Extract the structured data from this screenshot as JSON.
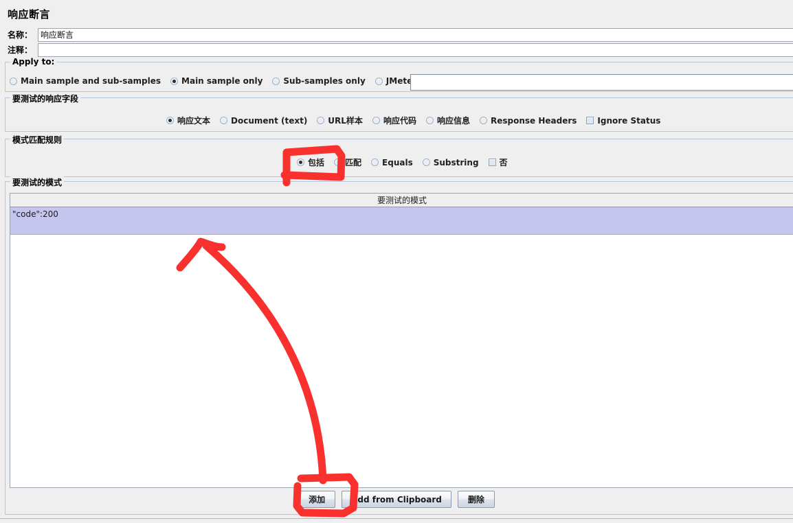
{
  "window": {
    "title": "响应断言"
  },
  "fields": {
    "name_label": "名称：",
    "name_value": "响应断言",
    "comment_label": "注释：",
    "comment_value": ""
  },
  "apply_to": {
    "title": "Apply to:",
    "options": [
      {
        "label": "Main sample and sub-samples",
        "selected": false
      },
      {
        "label": "Main sample only",
        "selected": true
      },
      {
        "label": "Sub-samples only",
        "selected": false
      },
      {
        "label": "JMeter Variable",
        "selected": false
      }
    ],
    "variable_value": ""
  },
  "response_field": {
    "title": "要测试的响应字段",
    "options": [
      {
        "label": "响应文本",
        "selected": true
      },
      {
        "label": "Document (text)",
        "selected": false
      },
      {
        "label": "URL样本",
        "selected": false
      },
      {
        "label": "响应代码",
        "selected": false
      },
      {
        "label": "响应信息",
        "selected": false
      },
      {
        "label": "Response Headers",
        "selected": false
      }
    ],
    "ignore_status": {
      "label": "Ignore Status",
      "checked": false
    }
  },
  "match_rules": {
    "title": "模式匹配规则",
    "options": [
      {
        "label": "包括",
        "selected": true
      },
      {
        "label": "匹配",
        "selected": false
      },
      {
        "label": "Equals",
        "selected": false
      },
      {
        "label": "Substring",
        "selected": false
      }
    ],
    "negate": {
      "label": "否",
      "checked": false
    }
  },
  "patterns": {
    "title": "要测试的模式",
    "column_header": "要测试的模式",
    "rows": [
      {
        "value": "\"code\":200",
        "selected": true
      }
    ]
  },
  "buttons": {
    "add": "添加",
    "add_from_clipboard": "Add from Clipboard",
    "delete": "删除"
  },
  "annotations": {
    "color": "#f8312f",
    "highlight_contains": "包括",
    "highlight_add_button": "添加",
    "arrow_from": "添加",
    "arrow_to": "要测试的模式"
  }
}
